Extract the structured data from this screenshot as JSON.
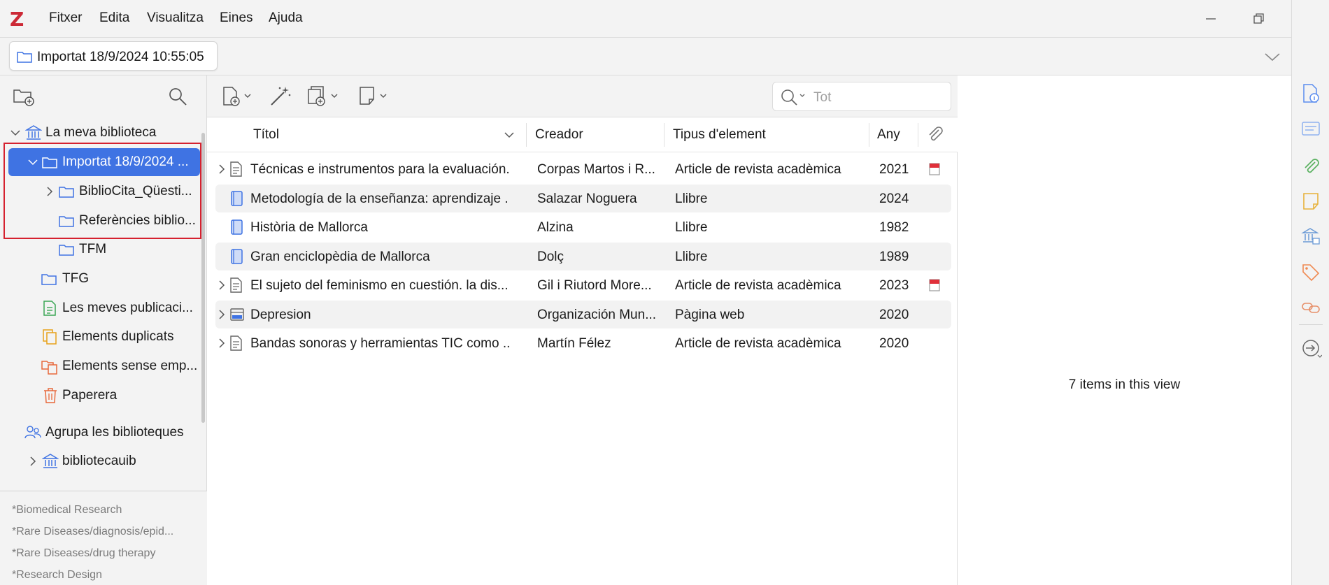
{
  "app": {
    "logo": "Z"
  },
  "menubar": {
    "items": [
      "Fitxer",
      "Edita",
      "Visualitza",
      "Eines",
      "Ajuda"
    ]
  },
  "tab": {
    "label": "Importat 18/9/2024 10:55:05"
  },
  "collections": {
    "library": "La meva biblioteca",
    "imported": "Importat 18/9/2024 ...",
    "bibliocita": "BiblioCita_Qüesti...",
    "references": "Referències biblio...",
    "tfm": "TFM",
    "tfg": "TFG",
    "publications": "Les meves publicaci...",
    "duplicates": "Elements duplicats",
    "unfiled": "Elements sense emp...",
    "trash": "Paperera",
    "groups": "Agrupa les biblioteques",
    "group_lib": "bibliotecauib"
  },
  "tags": [
    "*Biomedical Research",
    "*Rare Diseases/diagnosis/epid...",
    "*Rare Diseases/drug therapy",
    "*Research Design"
  ],
  "search": {
    "placeholder": "Tot"
  },
  "columns": {
    "title": "Títol",
    "creator": "Creador",
    "type": "Tipus d'element",
    "year": "Any"
  },
  "items": [
    {
      "title": "Técnicas e instrumentos para la evaluación...",
      "creator": "Corpas Martos i R...",
      "type": "Article de revista acadèmica",
      "year": "2021",
      "icon": "article-icon",
      "expand": true,
      "pdf": true
    },
    {
      "title": "Metodología de la enseñanza: aprendizaje ...",
      "creator": "Salazar Noguera",
      "type": "Llibre",
      "year": "2024",
      "icon": "book-icon",
      "expand": false,
      "pdf": false
    },
    {
      "title": "Història de Mallorca",
      "creator": "Alzina",
      "type": "Llibre",
      "year": "1982",
      "icon": "book-icon",
      "expand": false,
      "pdf": false
    },
    {
      "title": "Gran enciclopèdia de Mallorca",
      "creator": "Dolç",
      "type": "Llibre",
      "year": "1989",
      "icon": "book-icon",
      "expand": false,
      "pdf": false
    },
    {
      "title": "El sujeto del feminismo en cuestión. la dis...",
      "creator": "Gil i Riutord More...",
      "type": "Article de revista acadèmica",
      "year": "2023",
      "icon": "article-icon",
      "expand": true,
      "pdf": true
    },
    {
      "title": "Depresion",
      "creator": "Organización Mun...",
      "type": "Pàgina web",
      "year": "2020",
      "icon": "webpage-icon",
      "expand": true,
      "pdf": false
    },
    {
      "title": "Bandas sonoras y herramientas TIC como ...",
      "creator": "Martín Félez",
      "type": "Article de revista acadèmica",
      "year": "2020",
      "icon": "article-icon",
      "expand": true,
      "pdf": false
    }
  ],
  "itempane": {
    "count_text": "7 items in this view"
  },
  "colors": {
    "accent": "#3f73e3",
    "logo": "#cc2936",
    "highlight_box": "#d5212f"
  }
}
